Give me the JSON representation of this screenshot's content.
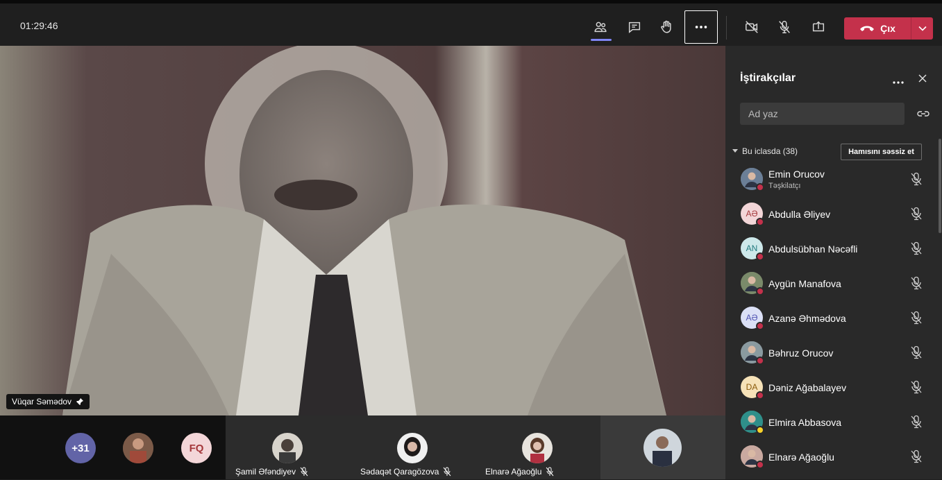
{
  "meeting": {
    "timer": "01:29:46"
  },
  "toolbar": {
    "participants_icon": "people-icon",
    "chat_icon": "chat-icon",
    "raise_hand_icon": "hand-icon",
    "more_icon": "more-icon",
    "camera_icon": "camera-off-icon",
    "mic_icon": "mic-off-icon",
    "share_icon": "share-screen-icon",
    "leave_label": "Çıx"
  },
  "main_video": {
    "speaker_name": "Vüqar Səmədov"
  },
  "strip": {
    "overflow_count": "+31",
    "initials_tile": "FQ",
    "tiles": [
      {
        "name": "Şamil Əfəndiyev"
      },
      {
        "name": "Sədaqət Qaragözova"
      },
      {
        "name": "Elnarə Ağaoğlu"
      }
    ]
  },
  "panel": {
    "title": "İştirakçılar",
    "search_placeholder": "Ad yaz",
    "section_label": "Bu iclasda (38)",
    "mute_all_label": "Hamısını səssiz et",
    "participants": [
      {
        "name": "Emin Orucov",
        "role": "Təşkilatçı",
        "initials": "",
        "color": "#6b7f97"
      },
      {
        "name": "Abdulla Əliyev",
        "role": "",
        "initials": "AƏ",
        "color": "#f3d6d8"
      },
      {
        "name": "Abdulsübhan Nəcəfli",
        "role": "",
        "initials": "AN",
        "color": "#cde8ea"
      },
      {
        "name": "Aygün Manafova",
        "role": "",
        "initials": "",
        "color": "#7a8a6a"
      },
      {
        "name": "Azanə Əhmədova",
        "role": "",
        "initials": "AƏ",
        "color": "#dbe0f6"
      },
      {
        "name": "Bəhruz Orucov",
        "role": "",
        "initials": "",
        "color": "#8a9aa0"
      },
      {
        "name": "Dəniz Ağabalayev",
        "role": "",
        "initials": "DA",
        "color": "#f6e2b8"
      },
      {
        "name": "Elmira Abbasova",
        "role": "",
        "initials": "",
        "color": "#2f8f8a"
      },
      {
        "name": "Elnarə Ağaoğlu",
        "role": "",
        "initials": "",
        "color": "#c9a9a0"
      }
    ]
  }
}
